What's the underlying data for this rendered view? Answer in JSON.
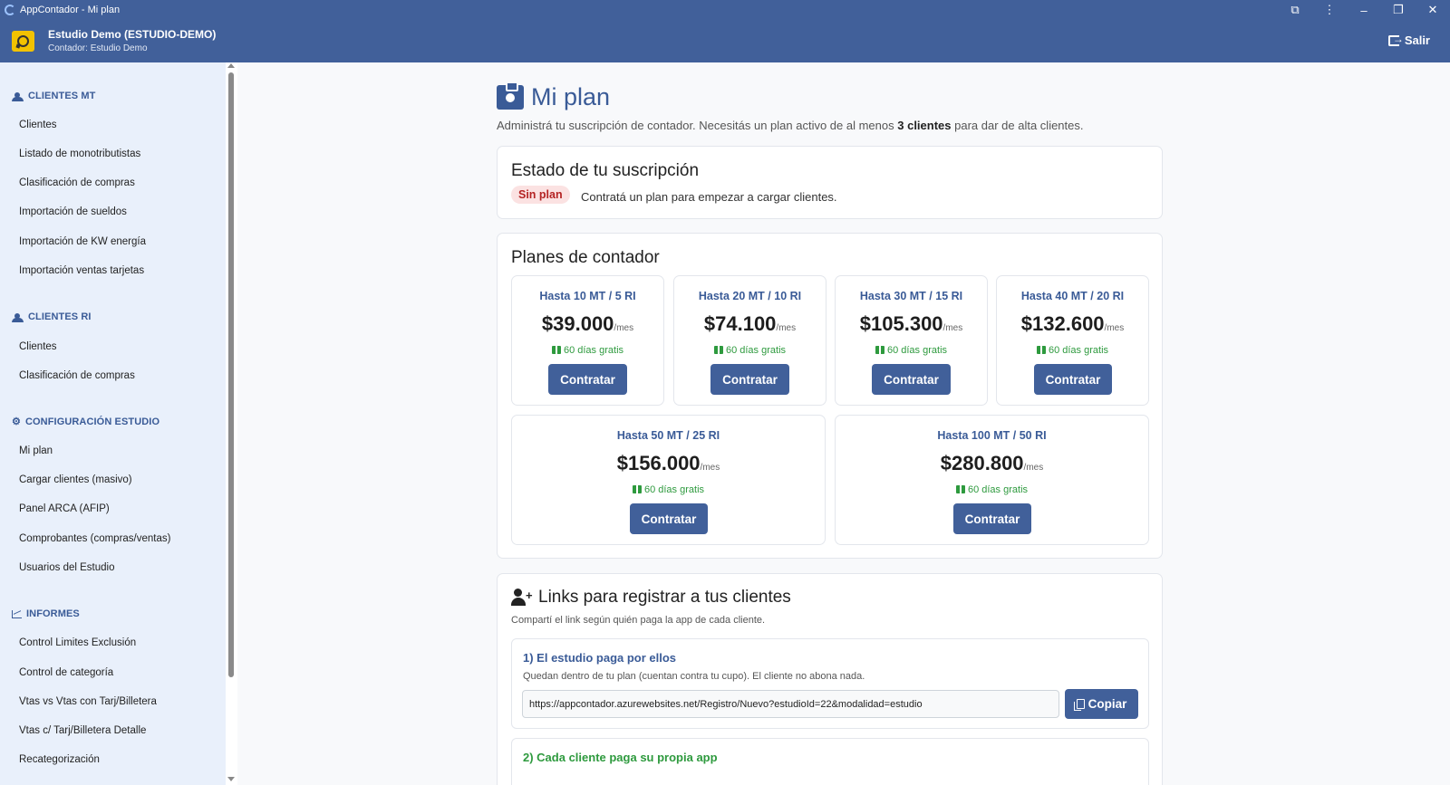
{
  "window": {
    "title": "AppContador - Mi plan"
  },
  "header": {
    "studio_name": "Estudio Demo (ESTUDIO-DEMO)",
    "contador_line": "Contador: Estudio Demo",
    "logout_label": "Salir"
  },
  "sidebar": {
    "sections": [
      {
        "title": "CLIENTES MT",
        "icon": "users-icon",
        "items": [
          "Clientes",
          "Listado de monotributistas",
          "Clasificación de compras",
          "Importación de sueldos",
          "Importación de KW energía",
          "Importación ventas tarjetas"
        ]
      },
      {
        "title": "CLIENTES RI",
        "icon": "users-icon",
        "items": [
          "Clientes",
          "Clasificación de compras"
        ]
      },
      {
        "title": "CONFIGURACIÓN ESTUDIO",
        "icon": "gears-icon",
        "items": [
          "Mi plan",
          "Cargar clientes (masivo)",
          "Panel ARCA (AFIP)",
          "Comprobantes (compras/ventas)",
          "Usuarios del Estudio"
        ]
      },
      {
        "title": "INFORMES",
        "icon": "chart-icon",
        "items": [
          "Control Limites Exclusión",
          "Control de categoría",
          "Vtas vs Vtas con Tarj/Billetera",
          "Vtas c/ Tarj/Billetera Detalle",
          "Recategorización"
        ]
      }
    ]
  },
  "page": {
    "title": "Mi plan",
    "subtitle_pre": "Administrá tu suscripción de contador. Necesitás un plan activo de al menos ",
    "subtitle_bold": "3 clientes",
    "subtitle_post": " para dar de alta clientes."
  },
  "subscription": {
    "title": "Estado de tu suscripción",
    "badge": "Sin plan",
    "message": "Contratá un plan para empezar a cargar clientes."
  },
  "plans": {
    "title": "Planes de contador",
    "price_suffix": "/mes",
    "free_label": "60 días gratis",
    "button_label": "Contratar",
    "items": [
      {
        "name": "Hasta 10 MT / 5 RI",
        "price": "$39.000"
      },
      {
        "name": "Hasta 20 MT / 10 RI",
        "price": "$74.100"
      },
      {
        "name": "Hasta 30 MT / 15 RI",
        "price": "$105.300"
      },
      {
        "name": "Hasta 40 MT / 20 RI",
        "price": "$132.600"
      },
      {
        "name": "Hasta 50 MT / 25 RI",
        "price": "$156.000"
      },
      {
        "name": "Hasta 100 MT / 50 RI",
        "price": "$280.800"
      }
    ]
  },
  "links": {
    "title": "Links para registrar a tus clientes",
    "subtitle": "Compartí el link según quién paga la app de cada cliente.",
    "option1": {
      "title": "1) El estudio paga por ellos",
      "desc": "Quedan dentro de tu plan (cuentan contra tu cupo). El cliente no abona nada.",
      "url": "https://appcontador.azurewebsites.net/Registro/Nuevo?estudioId=22&modalidad=estudio",
      "copy_label": "Copiar"
    },
    "option2": {
      "title": "2) Cada cliente paga su propia app"
    }
  },
  "colors": {
    "primary": "#41609a",
    "accent_text": "#3a5b97",
    "success": "#2e9a3e",
    "danger_bg": "#fbe2e2",
    "danger_text": "#b42323"
  }
}
